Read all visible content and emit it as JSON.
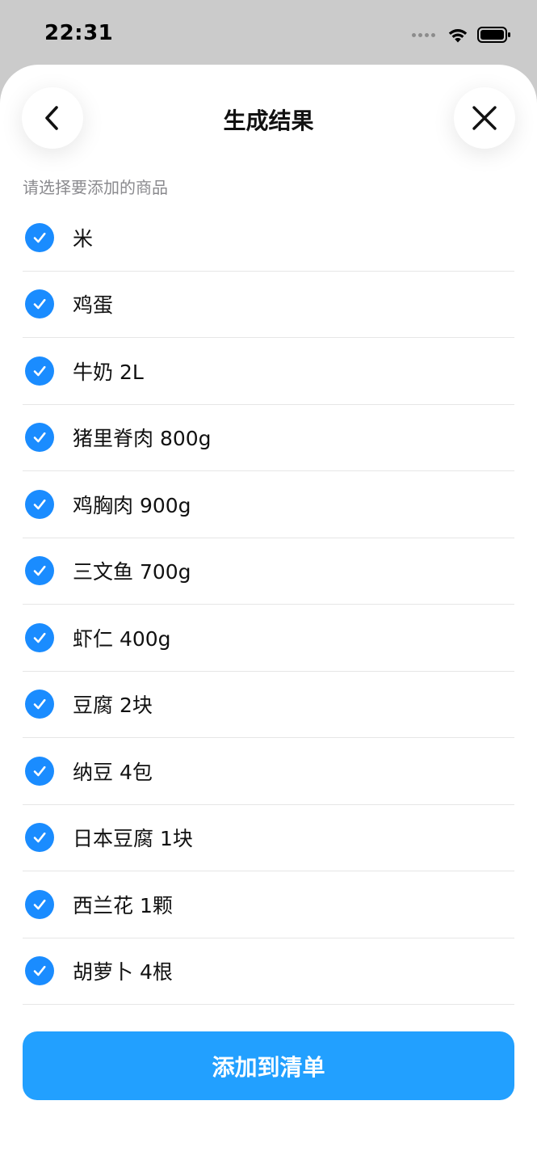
{
  "status_bar": {
    "time": "22:31"
  },
  "header": {
    "title": "生成结果",
    "back_icon": "chevron-left-icon",
    "close_icon": "close-icon"
  },
  "subtitle": "请选择要添加的商品",
  "items": [
    {
      "label": "米",
      "checked": true
    },
    {
      "label": "鸡蛋",
      "checked": true
    },
    {
      "label": "牛奶 2L",
      "checked": true
    },
    {
      "label": "猪里脊肉 800g",
      "checked": true
    },
    {
      "label": "鸡胸肉 900g",
      "checked": true
    },
    {
      "label": "三文鱼 700g",
      "checked": true
    },
    {
      "label": "虾仁 400g",
      "checked": true
    },
    {
      "label": "豆腐 2块",
      "checked": true
    },
    {
      "label": "纳豆 4包",
      "checked": true
    },
    {
      "label": "日本豆腐 1块",
      "checked": true
    },
    {
      "label": "西兰花 1颗",
      "checked": true
    },
    {
      "label": "胡萝卜 4根",
      "checked": true
    }
  ],
  "add_button_label": "添加到清单",
  "colors": {
    "accent": "#22a0ff",
    "check": "#1a8cff"
  }
}
